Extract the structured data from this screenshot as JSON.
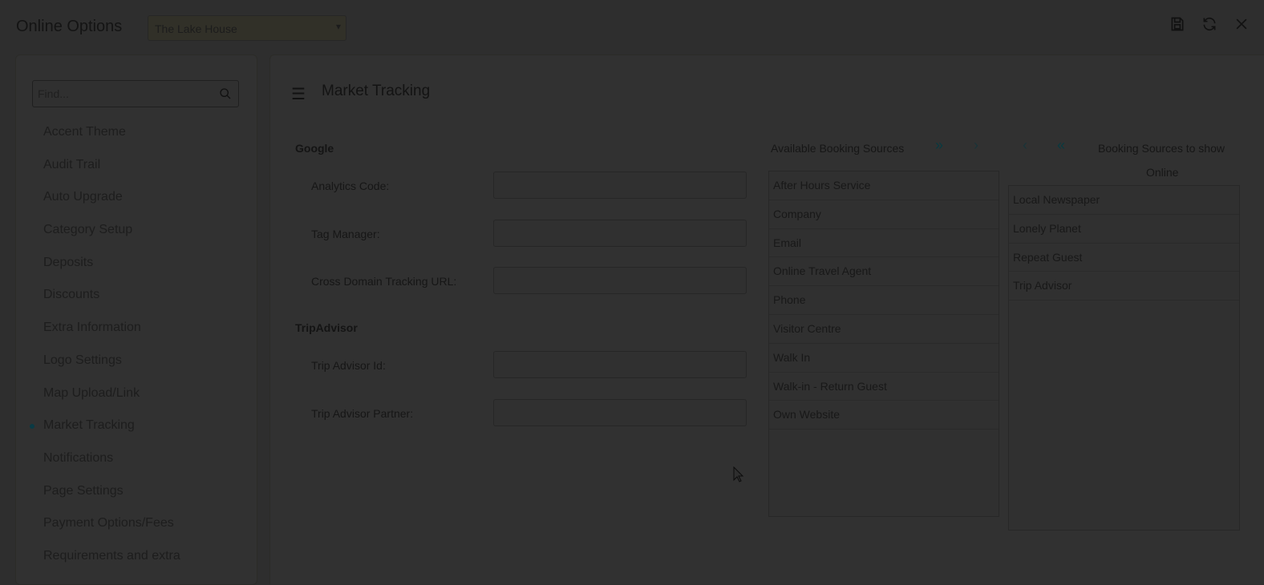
{
  "header": {
    "title": "Online Options",
    "property_select": "The Lake House",
    "icons": [
      "save-icon",
      "refresh-icon",
      "close-icon"
    ]
  },
  "sidebar": {
    "search_placeholder": "Find...",
    "items": [
      {
        "label": "Accent Theme"
      },
      {
        "label": "Audit Trail"
      },
      {
        "label": "Auto Upgrade"
      },
      {
        "label": "Category Setup"
      },
      {
        "label": "Deposits"
      },
      {
        "label": "Discounts"
      },
      {
        "label": "Extra Information"
      },
      {
        "label": "Logo Settings"
      },
      {
        "label": "Map Upload/Link"
      },
      {
        "label": "Market Tracking",
        "active": true
      },
      {
        "label": "Notifications"
      },
      {
        "label": "Page Settings"
      },
      {
        "label": "Payment Options/Fees"
      },
      {
        "label": "Requirements and extra"
      }
    ]
  },
  "main": {
    "title": "Market Tracking",
    "google": {
      "section": "Google",
      "analytics_label": "Analytics Code:",
      "analytics_value": "",
      "tag_manager_label": "Tag Manager:",
      "tag_manager_value": "",
      "cross_domain_label": "Cross Domain Tracking URL:",
      "cross_domain_value": ""
    },
    "tripadvisor": {
      "section": "TripAdvisor",
      "id_label": "Trip Advisor Id:",
      "id_value": "",
      "partner_label": "Trip Advisor Partner:",
      "partner_value": ""
    },
    "available_header": "Available Booking Sources",
    "selected_header_line1": "Booking Sources to show",
    "selected_header_line2": "Online",
    "available_sources": [
      "After Hours Service",
      "Company",
      "Email",
      "Online Travel Agent",
      "Phone",
      "Visitor Centre",
      "Walk In",
      "Walk-in - Return Guest",
      "Own Website"
    ],
    "selected_sources": [
      "Local Newspaper",
      "Lonely Planet",
      "Repeat Guest",
      "Trip Advisor"
    ]
  },
  "colors": {
    "accent": "#0a3a44",
    "overlay_bg": "#2e2e2e"
  }
}
